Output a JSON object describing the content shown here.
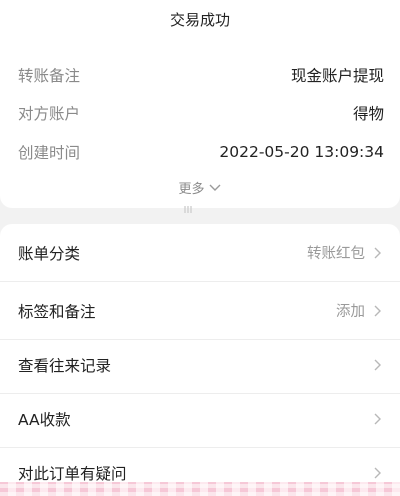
{
  "status": "交易成功",
  "details": [
    {
      "label": "转账备注",
      "value": "现金账户提现"
    },
    {
      "label": "对方账户",
      "value": "得物"
    },
    {
      "label": "创建时间",
      "value": "2022-05-20 13:09:34"
    }
  ],
  "more_label": "更多",
  "items": [
    {
      "label": "账单分类",
      "value": "转账红包"
    },
    {
      "label": "标签和备注",
      "value": "添加"
    },
    {
      "label": "查看往来记录",
      "value": ""
    },
    {
      "label": "AA收款",
      "value": ""
    },
    {
      "label": "对此订单有疑问",
      "value": ""
    }
  ],
  "colors": {
    "background": "#f2f2f2",
    "card": "#ffffff",
    "muted": "#8a8a8a",
    "footer_pattern": "#f6c3d3"
  }
}
